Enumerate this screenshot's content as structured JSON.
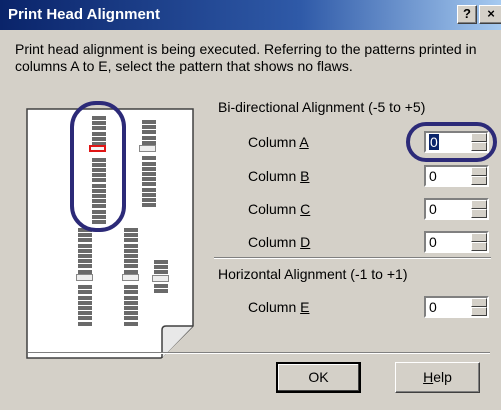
{
  "window": {
    "title": "Print Head Alignment",
    "help_glyph": "?",
    "close_glyph": "×"
  },
  "instruction": "Print head alignment is being executed. Referring to the patterns printed in columns A to E, select the pattern that shows no flaws.",
  "bidirectional": {
    "heading": "Bi-directional Alignment (-5 to +5)",
    "rows": [
      {
        "label_pre": "Column ",
        "accel": "A",
        "value": "0",
        "selected": true
      },
      {
        "label_pre": "Column ",
        "accel": "B",
        "value": "0"
      },
      {
        "label_pre": "Column ",
        "accel": "C",
        "value": "0"
      },
      {
        "label_pre": "Column ",
        "accel": "D",
        "value": "0"
      }
    ]
  },
  "horizontal": {
    "heading": "Horizontal Alignment (-1 to +1)",
    "rows": [
      {
        "label_pre": "Column ",
        "accel": "E",
        "value": "0"
      }
    ]
  },
  "buttons": {
    "ok": "OK",
    "help_accel": "H",
    "help_rest": "elp"
  },
  "icons": {
    "pattern_paper": "printed-pattern-sheet-icon",
    "highlight_oval": "highlight-oval-icon"
  },
  "colors": {
    "title_bar": "#0a246a",
    "highlight_oval": "#2c2a78",
    "red_pattern": "#e01515"
  }
}
